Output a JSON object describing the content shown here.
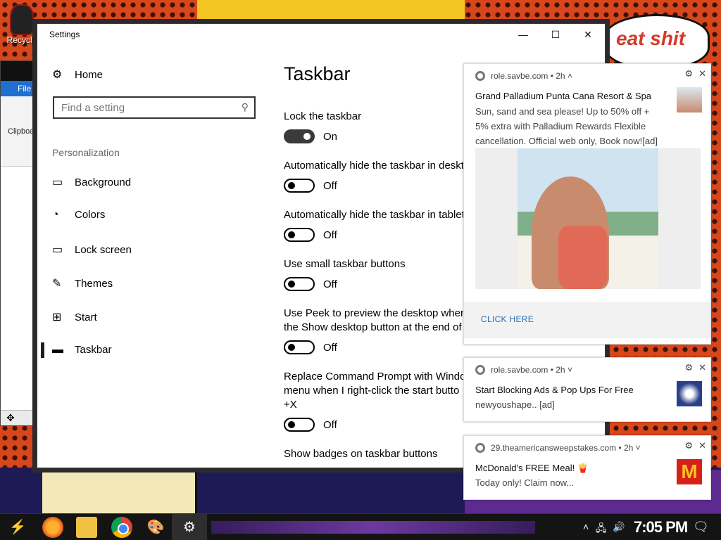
{
  "desktop": {
    "recycle_label": "Recycle",
    "speech_text": "eat shit"
  },
  "back_window": {
    "file_tab": "File",
    "clipboard": "Clipboa"
  },
  "settings": {
    "title": "Settings",
    "controls": {
      "minimize": "—",
      "maximize": "☐",
      "close": "✕"
    },
    "home_label": "Home",
    "search_placeholder": "Find a setting",
    "section_label": "Personalization",
    "nav": [
      {
        "label": "Background",
        "icon": "image-icon"
      },
      {
        "label": "Colors",
        "icon": "palette-icon"
      },
      {
        "label": "Lock screen",
        "icon": "lock-screen-icon"
      },
      {
        "label": "Themes",
        "icon": "themes-icon"
      },
      {
        "label": "Start",
        "icon": "start-icon"
      },
      {
        "label": "Taskbar",
        "icon": "taskbar-icon",
        "active": true
      }
    ],
    "page_title": "Taskbar",
    "options": [
      {
        "label": "Lock the taskbar",
        "state": "On",
        "on": true
      },
      {
        "label": "Automatically hide the taskbar in desktop mode",
        "state": "Off",
        "on": false
      },
      {
        "label": "Automatically hide the taskbar in tablet mode",
        "state": "Off",
        "on": false
      },
      {
        "label": "Use small taskbar buttons",
        "state": "Off",
        "on": false
      },
      {
        "label_line1": "Use Peek to preview the desktop when",
        "label_line2": "the Show desktop button at the end of",
        "state": "Off",
        "on": false
      },
      {
        "label_line1": "Replace Command Prompt with Windo",
        "label_line2": "menu when I right-click the start butto",
        "label_line3": "+X",
        "state": "Off",
        "on": false
      },
      {
        "label": "Show badges on taskbar buttons"
      }
    ]
  },
  "notifications": [
    {
      "source": "role.savbe.com",
      "age": "2h",
      "title": "Grand Palladium Punta Cana Resort & Spa",
      "body_line1": "Sun, sand and sea please! Up to 50% off +",
      "body_line2": "5% extra with Palladium Rewards Flexible",
      "body_line3": "cancellation. Official web only, Book now![ad]",
      "action": "CLICK HERE"
    },
    {
      "source": "role.savbe.com",
      "age": "2h",
      "title": "Start Blocking Ads & Pop Ups For Free",
      "body_line1": "newyoushape.. [ad]"
    },
    {
      "source": "29.theamericansweepstakes.com",
      "age": "2h",
      "title": "McDonald's FREE Meal! 🍟",
      "body_line1": "Today only! Claim now..."
    }
  ],
  "taskbar": {
    "clock": "7:05 PM"
  }
}
